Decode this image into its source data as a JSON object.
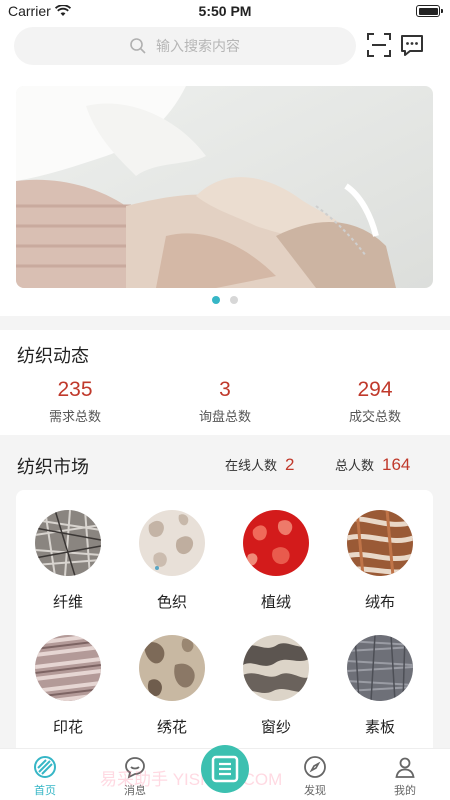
{
  "status": {
    "carrier": "Carrier",
    "time": "5:50 PM"
  },
  "search": {
    "placeholder": "输入搜索内容"
  },
  "dynamics": {
    "title": "纺织动态",
    "stats": [
      {
        "value": "235",
        "label": "需求总数"
      },
      {
        "value": "3",
        "label": "询盘总数"
      },
      {
        "value": "294",
        "label": "成交总数"
      }
    ]
  },
  "market": {
    "title": "纺织市场",
    "online_label": "在线人数",
    "online_value": "2",
    "total_label": "总人数",
    "total_value": "164",
    "categories": [
      {
        "label": "纤维"
      },
      {
        "label": "色织"
      },
      {
        "label": "植绒"
      },
      {
        "label": "绒布"
      },
      {
        "label": "印花"
      },
      {
        "label": "绣花"
      },
      {
        "label": "窗纱"
      },
      {
        "label": "素板"
      }
    ]
  },
  "tabbar": {
    "tabs": [
      {
        "label": "首页",
        "icon": "fabric-home-icon"
      },
      {
        "label": "消息",
        "icon": "chat-bubble-icon"
      },
      {
        "label": "",
        "icon": "center-action-icon"
      },
      {
        "label": "发现",
        "icon": "compass-icon"
      },
      {
        "label": "我的",
        "icon": "person-icon"
      }
    ]
  },
  "watermark": "易采助手 YISHZIZ.COM",
  "colors": {
    "accent": "#36b6c6",
    "stat_number": "#c0392b",
    "center_button": "#3cc0b0"
  }
}
